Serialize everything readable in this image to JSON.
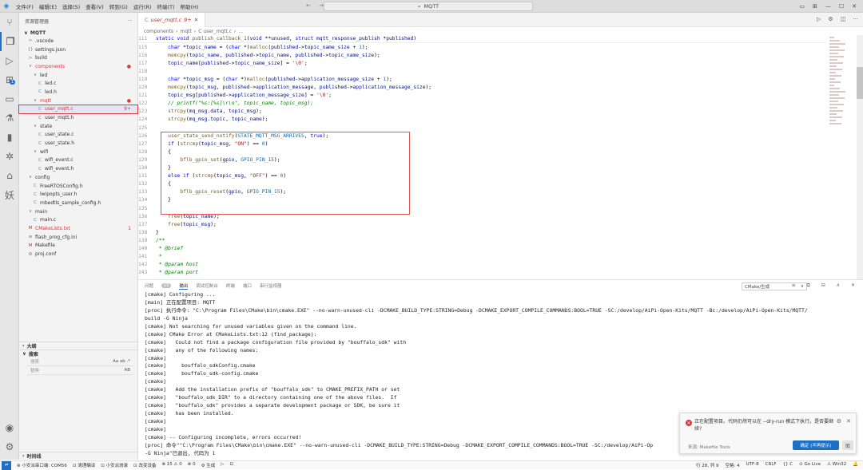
{
  "titlebar": {
    "menus": [
      "文件(F)",
      "编辑(E)",
      "选择(S)",
      "查看(V)",
      "转到(G)",
      "运行(R)",
      "终端(T)",
      "帮助(H)"
    ],
    "search": "MQTT",
    "nav": "← →",
    "controls": [
      "▭",
      "⊞",
      "—",
      "☐",
      "✕"
    ]
  },
  "sidebar": {
    "title": "资源管理器",
    "more": "···",
    "project": "MQTT",
    "tree": [
      {
        "label": ".vscode",
        "icon": ">",
        "depth": 1
      },
      {
        "label": "settings.json",
        "icon": "{}",
        "depth": 1
      },
      {
        "label": "build",
        "icon": ">",
        "depth": 1
      },
      {
        "label": "components",
        "icon": "∨",
        "depth": 1,
        "red": true,
        "dot": "●"
      },
      {
        "label": "led",
        "icon": "∨",
        "depth": 2
      },
      {
        "label": "led.c",
        "icon": "C",
        "depth": 3
      },
      {
        "label": "led.h",
        "icon": "C",
        "depth": 3
      },
      {
        "label": "mqtt",
        "icon": "∨",
        "depth": 2,
        "red": true,
        "dot": "●"
      },
      {
        "label": "user_mqtt.c",
        "icon": "C",
        "depth": 3,
        "red": true,
        "selected": true,
        "dot": "9+"
      },
      {
        "label": "user_mqtt.h",
        "icon": "C",
        "depth": 3
      },
      {
        "label": "state",
        "icon": "∨",
        "depth": 2
      },
      {
        "label": "user_state.c",
        "icon": "C",
        "depth": 3
      },
      {
        "label": "user_state.h",
        "icon": "C",
        "depth": 3
      },
      {
        "label": "wifi",
        "icon": "∨",
        "depth": 2
      },
      {
        "label": "wifi_event.c",
        "icon": "C",
        "depth": 3
      },
      {
        "label": "wifi_event.h",
        "icon": "C",
        "depth": 3
      },
      {
        "label": "config",
        "icon": "∨",
        "depth": 1
      },
      {
        "label": "FreeRTOSConfig.h",
        "icon": "C",
        "depth": 2
      },
      {
        "label": "lwipopts_user.h",
        "icon": "C",
        "depth": 2
      },
      {
        "label": "mbedtls_sample_config.h",
        "icon": "C",
        "depth": 2
      },
      {
        "label": "main",
        "icon": "∨",
        "depth": 1
      },
      {
        "label": "main.c",
        "icon": "C",
        "depth": 2
      },
      {
        "label": "CMakeLists.txt",
        "icon": "M",
        "depth": 1,
        "red": true,
        "dot": "1"
      },
      {
        "label": "flash_prog_cfg.ini",
        "icon": "≡",
        "depth": 1
      },
      {
        "label": "Makefile",
        "icon": "M",
        "depth": 1
      },
      {
        "label": "proj.conf",
        "icon": "⚙",
        "depth": 1
      }
    ],
    "outline_label": "大纲",
    "search_label": "搜索",
    "search_placeholder": "搜索",
    "search_opts": "Aa  ab  .*",
    "replace_placeholder": "替换",
    "replace_opts": "AB",
    "timeline_label": "时间线"
  },
  "editor": {
    "tab_label": "user_mqtt.c",
    "tab_badge": "9+",
    "tab_close": "✕",
    "tools": [
      "▷",
      "⚙",
      "◫",
      "···"
    ],
    "breadcrumb": [
      "components",
      "mqtt",
      "C user_mqtt.c",
      "..."
    ],
    "sticky_line": {
      "num": "111",
      "text": "static void publish_callback_1(void **unused, struct mqtt_response_publish *published)"
    },
    "lines": [
      {
        "num": "115",
        "text": "    char *topic_name = (char *)malloc(published->topic_name_size + 1);"
      },
      {
        "num": "116",
        "text": "    memcpy(topic_name, published->topic_name, published->topic_name_size);"
      },
      {
        "num": "117",
        "text": "    topic_name[published->topic_name_size] = '\\0';"
      },
      {
        "num": "118",
        "text": ""
      },
      {
        "num": "119",
        "text": "    char *topic_msg = (char *)malloc(published->application_message_size + 1);"
      },
      {
        "num": "120",
        "text": "    memcpy(topic_msg, published->application_message, published->application_message_size);"
      },
      {
        "num": "121",
        "text": "    topic_msg[published->application_message_size] = '\\0';"
      },
      {
        "num": "122",
        "text": "    // printf(\"%s:[%s]\\r\\n\", topic_name, topic_msg);",
        "comment": true
      },
      {
        "num": "123",
        "text": "    strcpy(mq_msg.data, topic_msg);"
      },
      {
        "num": "124",
        "text": "    strcpy(mq_msg.topic, topic_name);"
      },
      {
        "num": "125",
        "text": ""
      },
      {
        "num": "126",
        "text": "    user_state_send_notify(STATE_MQTT_MSG_ARRIVES, true);"
      },
      {
        "num": "127",
        "text": "    if (strcmp(topic_msg, \"ON\") == 0)"
      },
      {
        "num": "128",
        "text": "    {"
      },
      {
        "num": "129",
        "text": "        bflb_gpio_set(gpio, GPIO_PIN_15);"
      },
      {
        "num": "130",
        "text": "    }"
      },
      {
        "num": "131",
        "text": "    else if (strcmp(topic_msg, \"OFF\") == 0)"
      },
      {
        "num": "132",
        "text": "    {"
      },
      {
        "num": "133",
        "text": "        bflb_gpio_reset(gpio, GPIO_PIN_15);"
      },
      {
        "num": "134",
        "text": "    }"
      },
      {
        "num": "135",
        "text": ""
      },
      {
        "num": "136",
        "text": "    free(topic_name);"
      },
      {
        "num": "137",
        "text": "    free(topic_msg);"
      },
      {
        "num": "138",
        "text": "}"
      },
      {
        "num": "139",
        "text": "/**",
        "comment2": true
      },
      {
        "num": "140",
        "text": " * @brief",
        "comment2": true
      },
      {
        "num": "141",
        "text": " *",
        "comment2": true
      },
      {
        "num": "142",
        "text": " * @param host",
        "comment2": true
      },
      {
        "num": "143",
        "text": " * @param port",
        "comment2": true
      }
    ]
  },
  "panel": {
    "tabs": [
      "问题",
      "输出",
      "调试控制台",
      "终端",
      "端口",
      "串行监视器"
    ],
    "problems_count": "15",
    "active_tab": "输出",
    "select_value": "CMake/生成",
    "tools": "≡ ⧉ ⊟ ∧ ✕",
    "output": [
      "[cmake] Configuring ...",
      "[main] 正在配置项目: MQTT",
      "[proc] 执行命令: \"C:\\Program Files\\CMake\\bin\\cmake.EXE\" --no-warn-unused-cli -DCMAKE_BUILD_TYPE:STRING=Debug -DCMAKE_EXPORT_COMPILE_COMMANDS:BOOL=TRUE -SC:/develop/AiPi-Open-Kits/MQTT -Bc:/develop/AiPi-Open-Kits/MQTT/",
      "build -G Ninja",
      "[cmake] Not searching for unused variables given on the command line.",
      "[cmake] CMake Error at CMakeLists.txt:12 (find_package):",
      "[cmake]   Could not find a package configuration file provided by \"bouffalo_sdk\" with",
      "[cmake]   any of the following names:",
      "[cmake]",
      "[cmake]     bouffalo_sdkConfig.cmake",
      "[cmake]     bouffalo_sdk-config.cmake",
      "[cmake]",
      "[cmake]   Add the installation prefix of \"bouffalo_sdk\" to CMAKE_PREFIX_PATH or set",
      "[cmake]   \"bouffalo_sdk_DIR\" to a directory containing one of the above files.  If",
      "[cmake]   \"bouffalo_sdk\" provides a separate development package or SDK, be sure it",
      "[cmake]   has been installed.",
      "[cmake]",
      "[cmake]",
      "[cmake] -- Configuring incomplete, errors occurred!",
      "[proc] 命令\"\"C:\\Program Files\\CMake\\bin\\cmake.EXE\" --no-warn-unused-cli -DCMAKE_BUILD_TYPE:STRING=Debug -DCMAKE_EXPORT_COMPILE_COMMANDS:BOOL=TRUE -SC:/develop/AiPi-Op",
      "-G Ninja\"已退出, 代码为 1"
    ]
  },
  "toast": {
    "message": "正在配置项目。代码仍然可以在 --dry-run 模式下执行。是否要继续?",
    "source": "来源: Makefile Tools",
    "confirm": "确定 (不再提示)",
    "cancel": "取",
    "gear": "⚙",
    "close": "✕"
  },
  "statusbar": {
    "remote": "⇌",
    "left": [
      "⊗ 小安派串口端: COM56",
      "⊡ 清理编译",
      "⊡ 小安派烧录",
      "⊡ 改变设备",
      "⊗ 15 ⚠ 0",
      "⊗ 0",
      "⚙ 生成",
      "▷",
      "⊡"
    ],
    "right": [
      "行 28, 列 9",
      "空格: 4",
      "UTF-8",
      "CRLF",
      "{} C",
      "⊙ Go Live",
      "⚠ Win32",
      "🔔"
    ]
  },
  "colors": {
    "accent": "#1f6fc5",
    "error": "#d73a3a",
    "highlight_box": "#e05252"
  }
}
